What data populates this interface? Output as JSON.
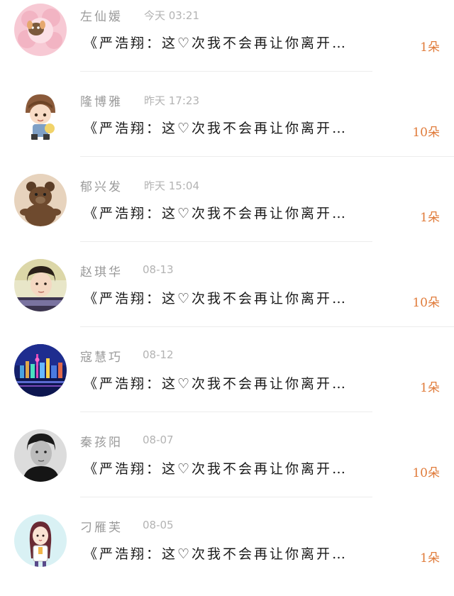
{
  "messages": [
    {
      "sender": "左仙媛",
      "time": "今天 03:21",
      "preview": "《严浩翔：这♡次我不会再让你离开…",
      "count": "1朵",
      "avatar_icon": "sheep-avatar-icon"
    },
    {
      "sender": "隆博雅",
      "time": "昨天 17:23",
      "preview": "《严浩翔：这♡次我不会再让你离开…",
      "count": "10朵",
      "avatar_icon": "cartoon-boy-avatar-icon"
    },
    {
      "sender": "郁兴发",
      "time": "昨天 15:04",
      "preview": "《严浩翔：这♡次我不会再让你离开…",
      "count": "1朵",
      "avatar_icon": "teddy-bear-avatar-icon"
    },
    {
      "sender": "赵琪华",
      "time": "08-13",
      "preview": "《严浩翔：这♡次我不会再让你离开…",
      "count": "10朵",
      "avatar_icon": "photo-boy-avatar-icon"
    },
    {
      "sender": "寇慧巧",
      "time": "08-12",
      "preview": "《严浩翔：这♡次我不会再让你离开…",
      "count": "1朵",
      "avatar_icon": "city-night-avatar-icon"
    },
    {
      "sender": "秦孩阳",
      "time": "08-07",
      "preview": "《严浩翔：这♡次我不会再让你离开…",
      "count": "10朵",
      "avatar_icon": "bw-portrait-avatar-icon"
    },
    {
      "sender": "刁雁芙",
      "time": "08-05",
      "preview": "《严浩翔：这♡次我不会再让你离开…",
      "count": "1朵",
      "avatar_icon": "cartoon-girl-avatar-icon"
    }
  ],
  "colors": {
    "name": "#9a9a9a",
    "time": "#b3b3b3",
    "preview": "#1a1a1a",
    "count": "#e07b3a",
    "divider": "#ececec"
  }
}
